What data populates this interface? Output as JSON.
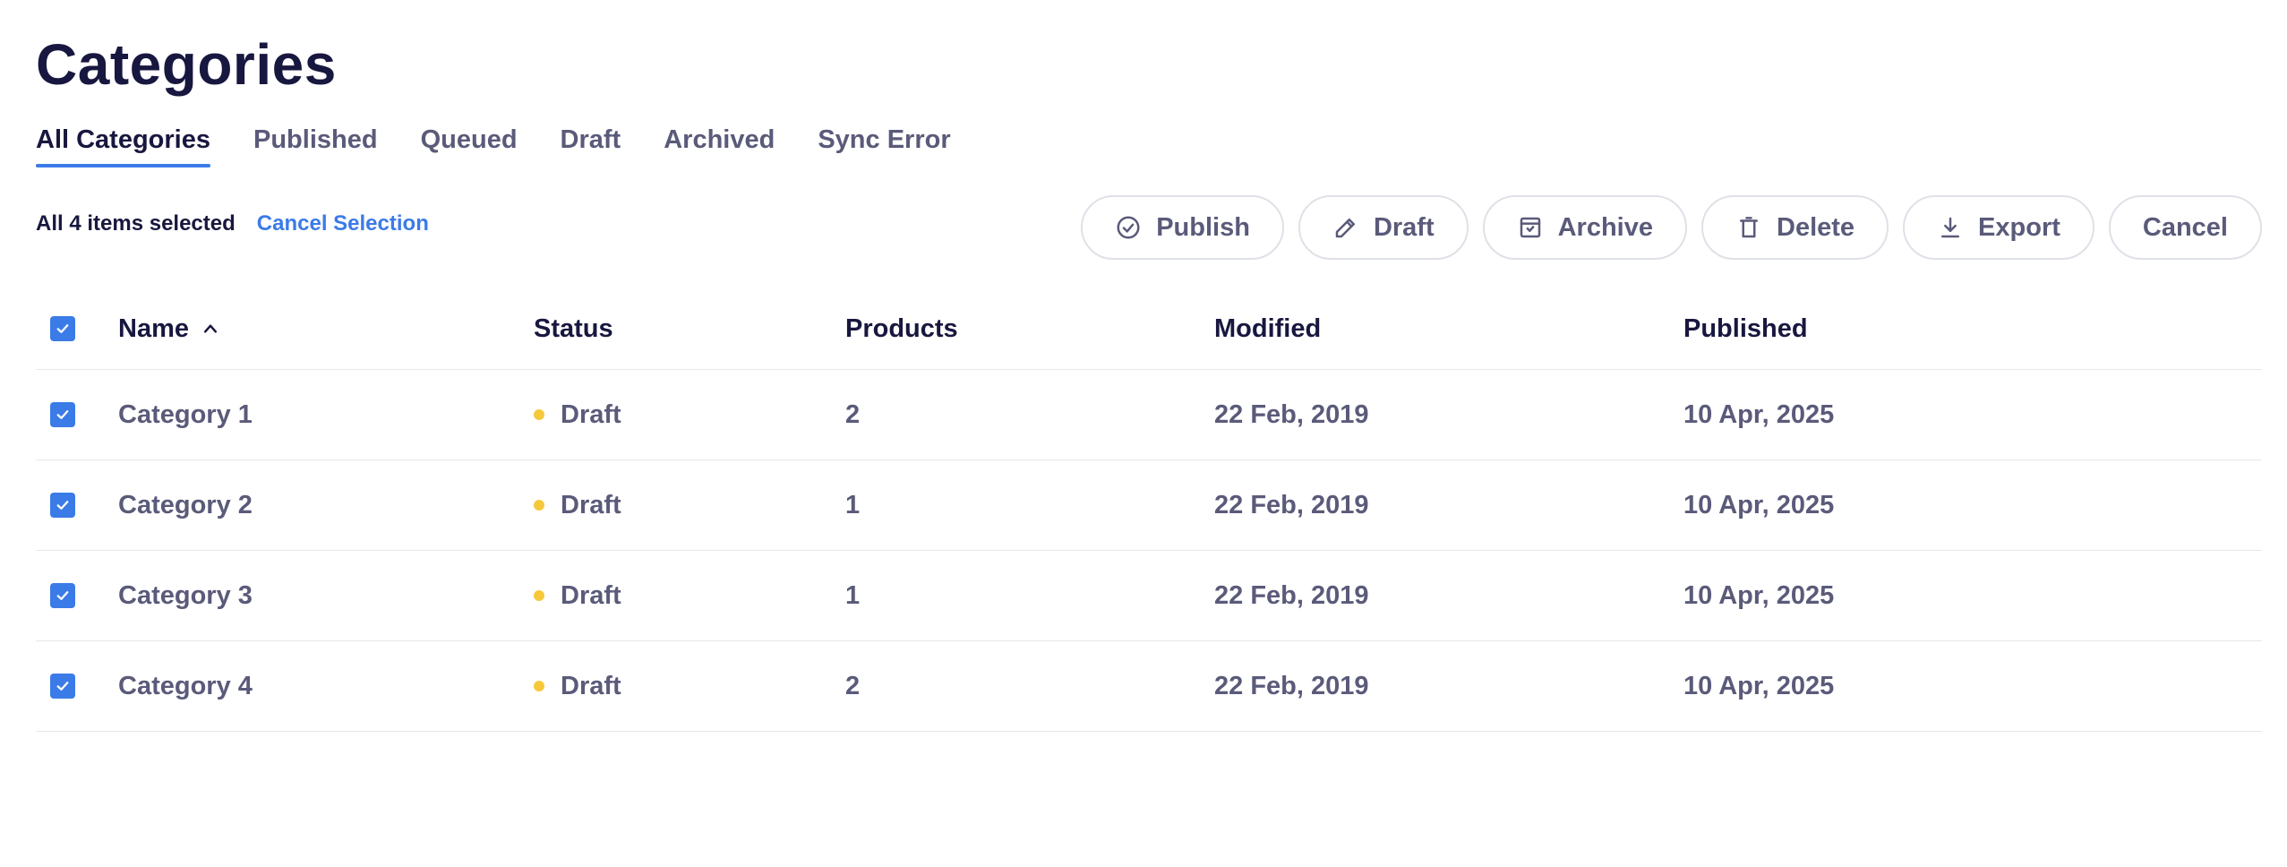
{
  "page": {
    "title": "Categories"
  },
  "tabs": [
    {
      "label": "All Categories",
      "active": true
    },
    {
      "label": "Published",
      "active": false
    },
    {
      "label": "Queued",
      "active": false
    },
    {
      "label": "Draft",
      "active": false
    },
    {
      "label": "Archived",
      "active": false
    },
    {
      "label": "Sync Error",
      "active": false
    }
  ],
  "selection": {
    "count_text": "All 4 items selected",
    "cancel_label": "Cancel Selection"
  },
  "actions": {
    "publish": {
      "label": "Publish",
      "icon": "check-circle-icon"
    },
    "draft": {
      "label": "Draft",
      "icon": "pencil-icon"
    },
    "archive": {
      "label": "Archive",
      "icon": "archive-box-icon"
    },
    "delete": {
      "label": "Delete",
      "icon": "trash-icon"
    },
    "export": {
      "label": "Export",
      "icon": "download-icon"
    },
    "cancel": {
      "label": "Cancel"
    }
  },
  "table": {
    "columns": {
      "name": "Name",
      "status": "Status",
      "products": "Products",
      "modified": "Modified",
      "published": "Published"
    },
    "sort": {
      "column": "Name",
      "direction": "ascending"
    },
    "rows": [
      {
        "name": "Category 1",
        "status": "Draft",
        "products": "2",
        "modified": "22 Feb, 2019",
        "published": "10 Apr, 2025",
        "checked": true
      },
      {
        "name": "Category 2",
        "status": "Draft",
        "products": "1",
        "modified": "22 Feb, 2019",
        "published": "10 Apr, 2025",
        "checked": true
      },
      {
        "name": "Category 3",
        "status": "Draft",
        "products": "1",
        "modified": "22 Feb, 2019",
        "published": "10 Apr, 2025",
        "checked": true
      },
      {
        "name": "Category 4",
        "status": "Draft",
        "products": "2",
        "modified": "22 Feb, 2019",
        "published": "10 Apr, 2025",
        "checked": true
      }
    ]
  },
  "colors": {
    "accent": "#3b7be8",
    "draft_status": "#f5c93b",
    "title": "#18173f",
    "muted_text": "#5a5a7a"
  }
}
